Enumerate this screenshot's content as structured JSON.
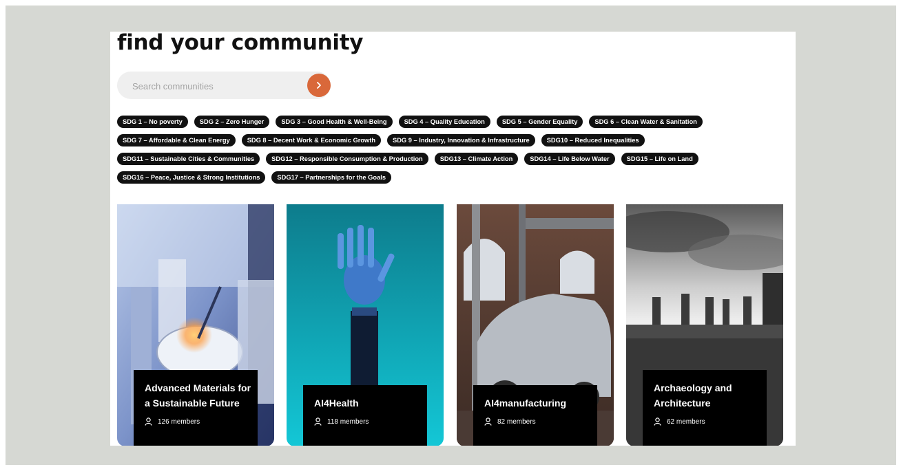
{
  "page_title": "find your community",
  "search": {
    "placeholder": "Search communities",
    "button_icon": "chevron-right-icon"
  },
  "colors": {
    "accent": "#d9683a",
    "tag_bg": "#111111",
    "frame_bg": "#d6d8d3"
  },
  "sdg_tags": [
    "SDG 1 – No poverty",
    "SDG 2 – Zero Hunger",
    "SDG 3 – Good Health & Well-Being",
    "SDG 4 – Quality Education",
    "SDG 5 – Gender Equality",
    "SDG 6 – Clean Water & Sanitation",
    "SDG 7 – Affordable & Clean Energy",
    "SDG 8 – Decent Work & Economic Growth",
    "SDG 9 – Industry, Innovation & Infrastructure",
    "SDG10 – Reduced Inequalities",
    "SDG11 – Sustainable Cities & Communities",
    "SDG12 – Responsible Consumption & Production",
    "SDG13 – Climate Action",
    "SDG14 – Life Below Water",
    "SDG15 – Life on Land",
    "SDG16 – Peace, Justice & Strong Institutions",
    "SDG17 – Partnerships for the Goals"
  ],
  "communities": [
    {
      "name_line1": "Advanced Materials for",
      "name_line2": "a Sustainable Future",
      "members": "126 members"
    },
    {
      "name_line1": "AI4Health",
      "name_line2": "",
      "members": "118 members"
    },
    {
      "name_line1": "AI4manufacturing",
      "name_line2": "",
      "members": "82 members"
    },
    {
      "name_line1": "Archaeology and",
      "name_line2": "Architecture",
      "members": "62 members"
    }
  ]
}
